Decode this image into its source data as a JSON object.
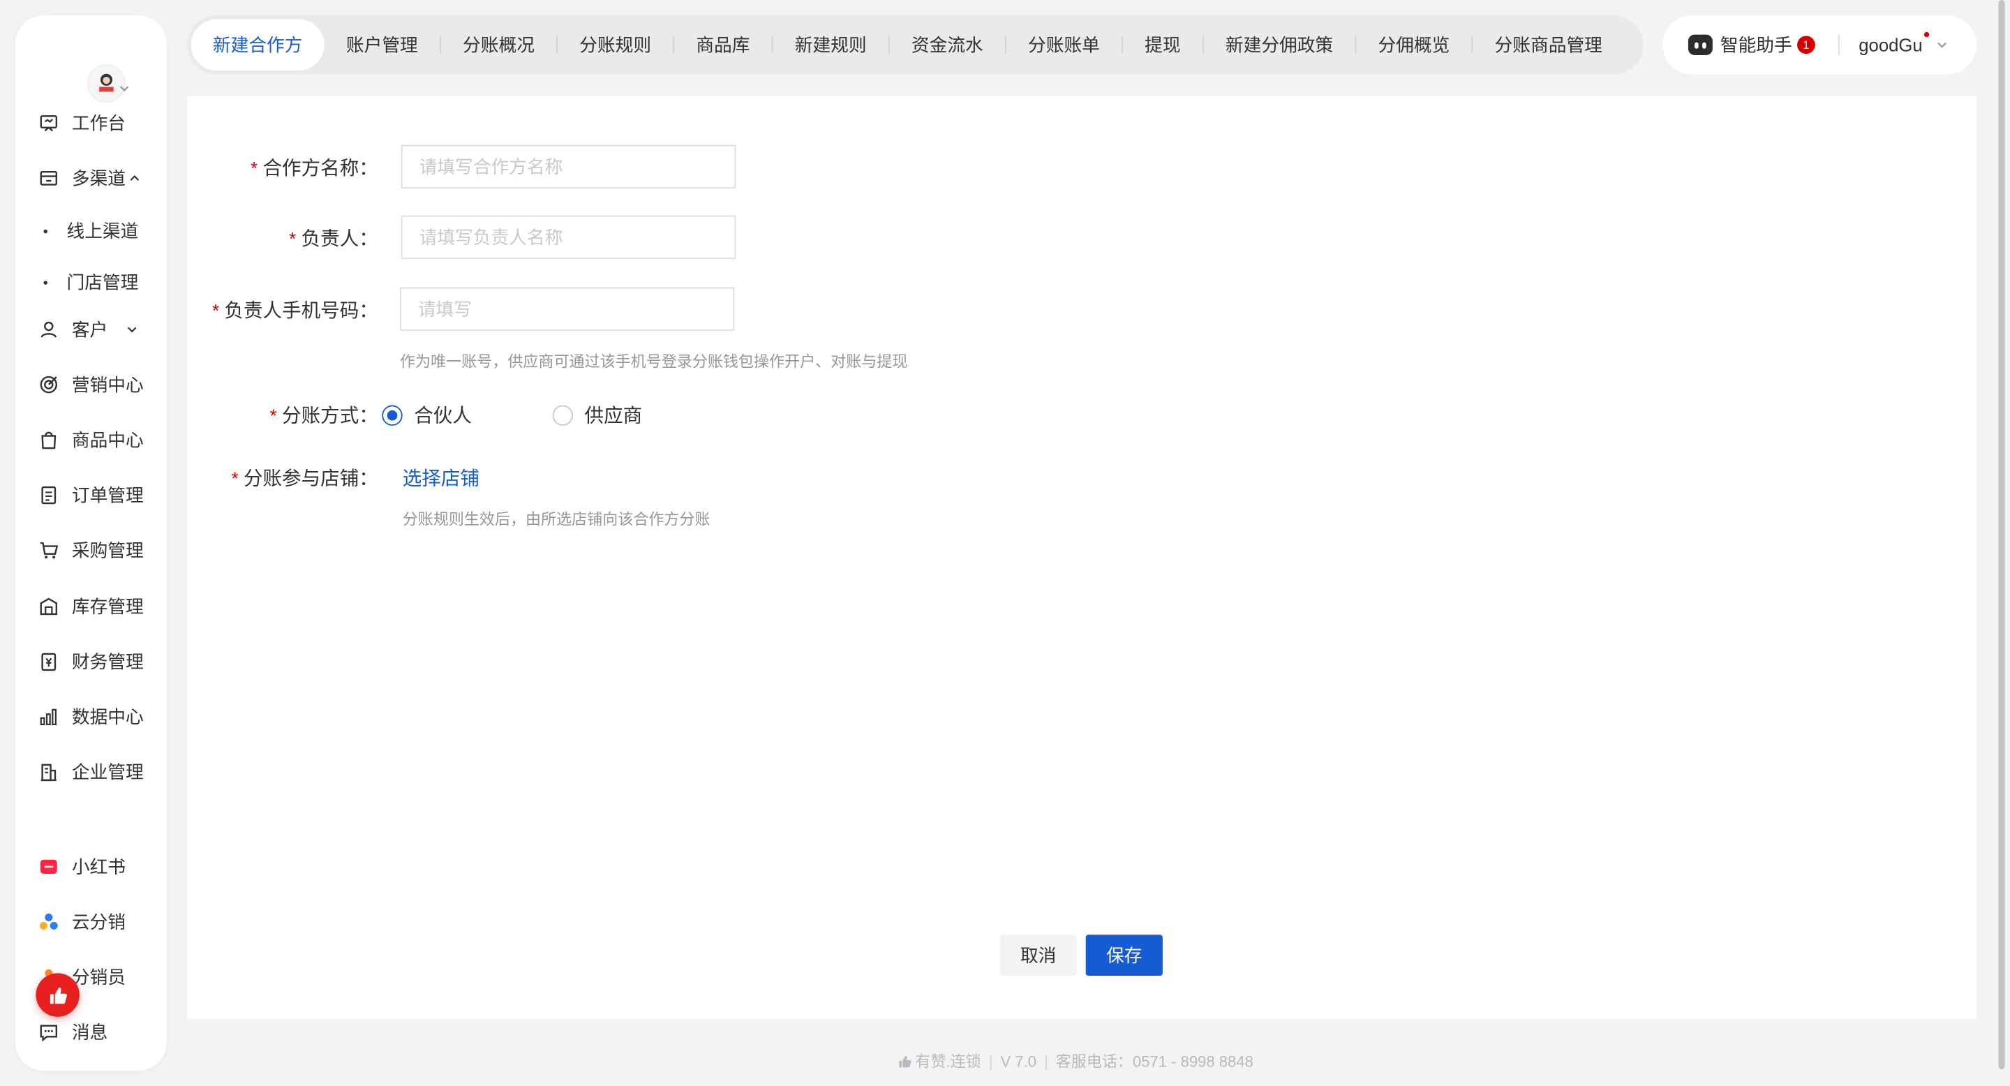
{
  "sidebar": {
    "items": [
      {
        "label": "工作台",
        "icon": "workbench-icon"
      },
      {
        "label": "多渠道",
        "icon": "store-icon"
      },
      {
        "label": "客户",
        "icon": "user-icon"
      },
      {
        "label": "营销中心",
        "icon": "target-icon"
      },
      {
        "label": "商品中心",
        "icon": "bag-icon"
      },
      {
        "label": "订单管理",
        "icon": "order-icon"
      },
      {
        "label": "采购管理",
        "icon": "cart-icon"
      },
      {
        "label": "库存管理",
        "icon": "warehouse-icon"
      },
      {
        "label": "财务管理",
        "icon": "finance-icon"
      },
      {
        "label": "数据中心",
        "icon": "chart-icon"
      },
      {
        "label": "企业管理",
        "icon": "building-icon"
      }
    ],
    "sub_items": [
      "线上渠道",
      "门店管理"
    ],
    "apps": [
      {
        "label": "小红书",
        "icon": "xiaohongshu-icon"
      },
      {
        "label": "云分销",
        "icon": "cloud-distribution-icon"
      },
      {
        "label": "分销员",
        "icon": "distributor-icon"
      },
      {
        "label": "消息",
        "icon": "message-icon"
      }
    ]
  },
  "tabs": [
    "新建合作方",
    "账户管理",
    "分账概况",
    "分账规则",
    "商品库",
    "新建规则",
    "资金流水",
    "分账账单",
    "提现",
    "新建分佣政策",
    "分佣概览",
    "分账商品管理"
  ],
  "active_tab": 0,
  "header": {
    "assistant_label": "智能助手",
    "assistant_badge": "1",
    "username": "goodGu"
  },
  "form": {
    "partner_name": {
      "label": "合作方名称：",
      "placeholder": "请填写合作方名称",
      "value": ""
    },
    "owner": {
      "label": "负责人：",
      "placeholder": "请填写负责人名称",
      "value": ""
    },
    "phone": {
      "label": "负责人手机号码：",
      "placeholder": "请填写",
      "value": "",
      "hint": "作为唯一账号，供应商可通过该手机号登录分账钱包操作开户、对账与提现"
    },
    "split_mode": {
      "label": "分账方式：",
      "options": [
        "合伙人",
        "供应商"
      ],
      "selected": "合伙人"
    },
    "stores": {
      "label": "分账参与店铺：",
      "link": "选择店铺",
      "hint": "分账规则生效后，由所选店铺向该合作方分账"
    },
    "required_mark": "*"
  },
  "actions": {
    "cancel": "取消",
    "save": "保存"
  },
  "footer": {
    "brand": "有赞.连锁",
    "version": "V 7.0",
    "hotline": "客服电话：0571 - 8998 8848"
  },
  "colors": {
    "primary": "#155bd4",
    "required": "#d40000",
    "badge": "#e61f1f"
  }
}
